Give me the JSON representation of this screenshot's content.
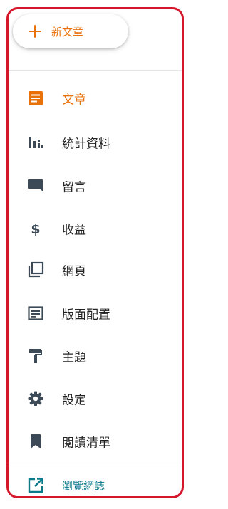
{
  "new_post": {
    "label": "新文章"
  },
  "nav": {
    "items": [
      {
        "label": "文章",
        "icon": "posts-icon",
        "active": true
      },
      {
        "label": "統計資料",
        "icon": "stats-icon"
      },
      {
        "label": "留言",
        "icon": "comment-icon"
      },
      {
        "label": "收益",
        "icon": "dollar-icon"
      },
      {
        "label": "網頁",
        "icon": "pages-icon"
      },
      {
        "label": "版面配置",
        "icon": "layout-icon"
      },
      {
        "label": "主題",
        "icon": "paint-roller-icon"
      },
      {
        "label": "設定",
        "icon": "gear-icon"
      },
      {
        "label": "閱讀清單",
        "icon": "bookmark-icon"
      }
    ],
    "view_blog": {
      "label": "瀏覽網誌",
      "icon": "open-in-new-icon"
    }
  },
  "colors": {
    "accent": "#e8710a",
    "icon": "#3c4a57",
    "link": "#0b7a8a",
    "frame": "#d6162b"
  }
}
